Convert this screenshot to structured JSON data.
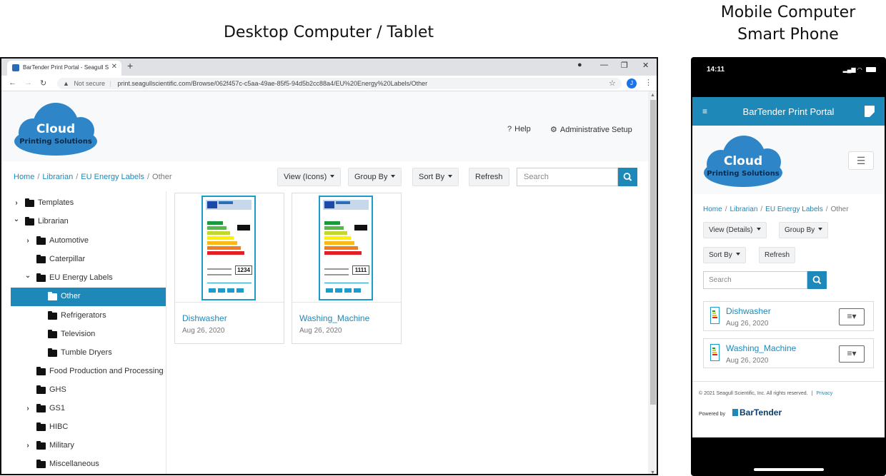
{
  "captions": {
    "desktop": "Desktop Computer / Tablet",
    "mobile_line1": "Mobile Computer",
    "mobile_line2": "Smart Phone"
  },
  "colors": {
    "accent": "#1e88b8",
    "logo_cloud": "#2e86c9",
    "selected_bg": "#1e88b8"
  },
  "browser": {
    "tab_title": "BarTender Print Portal - Seagull S",
    "address_security": "Not secure",
    "address_url": "print.seagullscientific.com/Browse/062f457c-c5aa-49ae-85f5-94d5b2cc88a4/EU%20Energy%20Labels/Other",
    "profile_initial": "J"
  },
  "logo": {
    "line1": "Cloud",
    "line2": "Printing Solutions"
  },
  "header": {
    "help": "Help",
    "admin": "Administrative Setup"
  },
  "breadcrumb": {
    "home": "Home",
    "librarian": "Librarian",
    "eu": "EU Energy Labels",
    "current": "Other"
  },
  "toolbar": {
    "view": "View (Icons)",
    "group": "Group By",
    "sort": "Sort By",
    "refresh": "Refresh",
    "search_placeholder": "Search"
  },
  "tree": [
    {
      "label": "Templates",
      "expander": "›"
    },
    {
      "label": "Librarian",
      "expander": "⌄"
    },
    {
      "label": "Automotive",
      "expander": "›"
    },
    {
      "label": "Caterpillar",
      "expander": ""
    },
    {
      "label": "EU Energy Labels",
      "expander": "⌄"
    },
    {
      "label": "Other",
      "expander": ""
    },
    {
      "label": "Refrigerators",
      "expander": ""
    },
    {
      "label": "Television",
      "expander": ""
    },
    {
      "label": "Tumble Dryers",
      "expander": ""
    },
    {
      "label": "Food Production and Processing",
      "expander": ""
    },
    {
      "label": "GHS",
      "expander": ""
    },
    {
      "label": "GS1",
      "expander": "›"
    },
    {
      "label": "HIBC",
      "expander": ""
    },
    {
      "label": "Military",
      "expander": "›"
    },
    {
      "label": "Miscellaneous",
      "expander": ""
    }
  ],
  "files": [
    {
      "name": "Dishwasher",
      "date": "Aug 26, 2020",
      "label_value": "1234"
    },
    {
      "name": "Washing_Machine",
      "date": "Aug 26, 2020",
      "label_value": "1111"
    }
  ],
  "mobile": {
    "time": "14:11",
    "app_title": "BarTender Print Portal",
    "view": "View (Details)",
    "group": "Group By",
    "sort": "Sort By",
    "refresh": "Refresh",
    "search_placeholder": "Search",
    "copyright": "© 2021 Seagull Scientific, Inc. All rights reserved.",
    "privacy": "Privacy",
    "powered_by": "Powered by",
    "brand": "BarTender"
  }
}
